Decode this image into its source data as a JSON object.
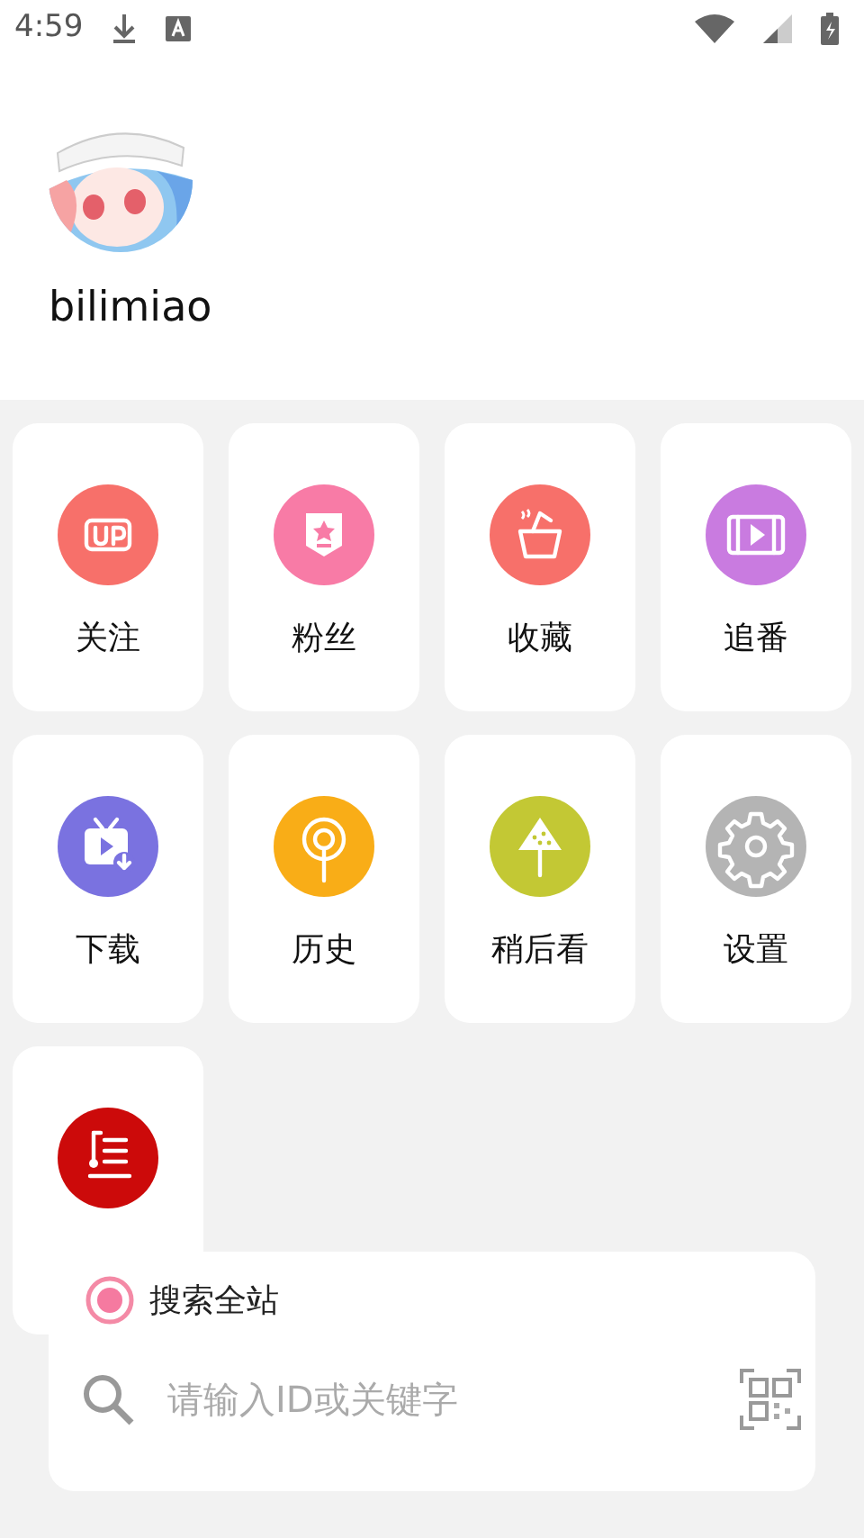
{
  "status_bar": {
    "time": "4:59"
  },
  "profile": {
    "username": "bilimiao"
  },
  "menu": [
    {
      "label": "关注",
      "color": "#f7706a"
    },
    {
      "label": "粉丝",
      "color": "#f87ba6"
    },
    {
      "label": "收藏",
      "color": "#f7706a"
    },
    {
      "label": "追番",
      "color": "#c97be0"
    },
    {
      "label": "下载",
      "color": "#7a72e0"
    },
    {
      "label": "历史",
      "color": "#f9ad17"
    },
    {
      "label": "稍后看",
      "color": "#c3c834"
    },
    {
      "label": "设置",
      "color": "#b4b4b4"
    },
    {
      "color": "#cc0a0a"
    }
  ],
  "search": {
    "option": {
      "label": "搜索全站",
      "selected": true
    },
    "placeholder": "请输入ID或关键字"
  }
}
